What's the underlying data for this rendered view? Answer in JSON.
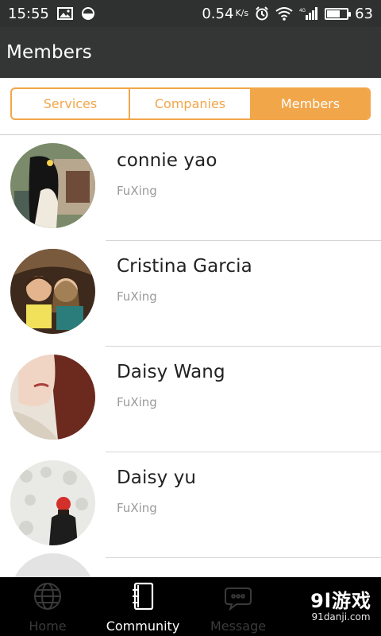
{
  "status_bar": {
    "time": "15:55",
    "net_speed": "0.54",
    "net_unit": "K/s",
    "network": "4G",
    "battery": "63",
    "battery_level": 0.63
  },
  "header": {
    "title": "Members"
  },
  "tabs": [
    {
      "label": "Services",
      "active": false
    },
    {
      "label": "Companies",
      "active": false
    },
    {
      "label": "Members",
      "active": true
    }
  ],
  "members": [
    {
      "name": "connie yao",
      "company": "FuXing"
    },
    {
      "name": "Cristina Garcia",
      "company": "FuXing"
    },
    {
      "name": "Daisy Wang",
      "company": "FuXing"
    },
    {
      "name": "Daisy yu",
      "company": "FuXing"
    }
  ],
  "bottom_nav": [
    {
      "label": "Home",
      "icon": "globe-icon",
      "active": false
    },
    {
      "label": "Community",
      "icon": "notebook-icon",
      "active": true
    },
    {
      "label": "Message",
      "icon": "chat-icon",
      "active": false
    }
  ],
  "watermark": {
    "main": "9l游戏",
    "sub": "91danji.com"
  },
  "colors": {
    "accent": "#f2a64a",
    "header": "#343535",
    "status_bar": "#2f3130",
    "nav": "#000000"
  }
}
